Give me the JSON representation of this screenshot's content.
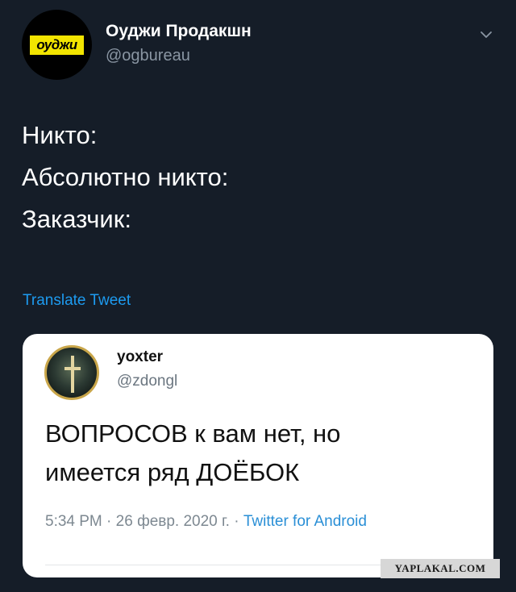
{
  "author": {
    "name": "Оуджи Продакшн",
    "handle": "@ogbureau",
    "avatar_logo": "оуджи"
  },
  "tweet": {
    "lines": [
      "Никто:",
      "Абсолютно никто:",
      "Заказчик:"
    ],
    "translate_label": "Translate Tweet"
  },
  "quoted": {
    "name": "yoxter",
    "handle": "@zdongl",
    "lines": [
      "ВОПРОСОВ к вам нет, но",
      "имеется ряд ДОЁБОК"
    ],
    "time": "5:34 PM",
    "date": "26 февр. 2020 г.",
    "source": "Twitter for Android",
    "separator": " · "
  },
  "watermark": "YAPLAKAL.COM",
  "colors": {
    "background": "#151d28",
    "link": "#1d9bf0",
    "logo_yellow": "#f2e400"
  },
  "icons": {
    "menu": "chevron-down-icon"
  }
}
